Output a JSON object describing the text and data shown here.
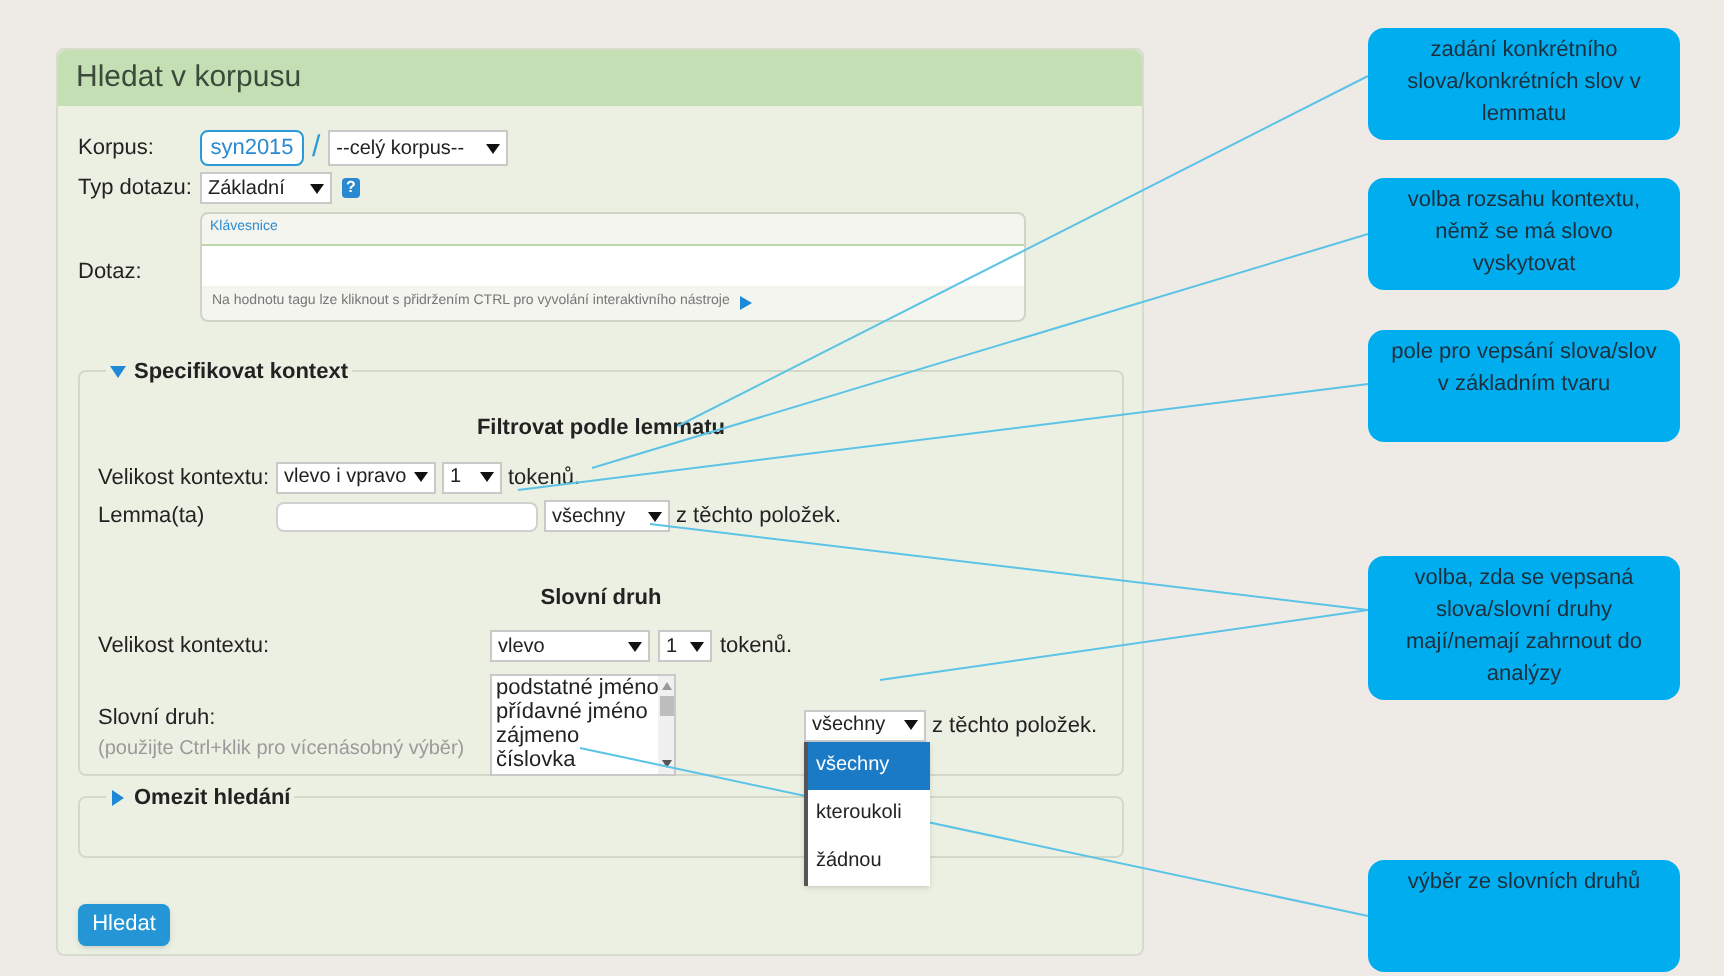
{
  "panel": {
    "title": "Hledat v korpusu"
  },
  "corpus": {
    "label": "Korpus:",
    "value": "syn2015",
    "separator": "/",
    "subcorpus": "--celý korpus--"
  },
  "query_type": {
    "label": "Typ dotazu:",
    "value": "Základní",
    "help": "?"
  },
  "query": {
    "label": "Dotaz:",
    "keyboard_tab": "Klávesnice",
    "hint": "Na hodnotu tagu lze kliknout s přidržením CTRL pro vyvolání interaktivního nástroje"
  },
  "context_section": {
    "title": "Specifikovat kontext",
    "expanded": true,
    "lemma_filter": {
      "heading": "Filtrovat podle lemmatu",
      "size_label": "Velikost kontextu:",
      "direction": "vlevo i vpravo",
      "count": "1",
      "unit": "tokenů.",
      "lemma_label": "Lemma(ta)",
      "mode": "všechny",
      "suffix": "z těchto položek."
    },
    "pos_filter": {
      "heading": "Slovní druh",
      "size_label": "Velikost kontextu:",
      "direction": "vlevo",
      "count": "1",
      "unit": "tokenů.",
      "pos_label": "Slovní druh:",
      "pos_hint": "(použijte Ctrl+klik pro vícenásobný výběr)",
      "pos_items": [
        {
          "label": "podstatné jméno",
          "selected": false
        },
        {
          "label": "přídavné jméno",
          "selected": false
        },
        {
          "label": "zájmeno",
          "selected": false
        },
        {
          "label": "číslovka",
          "selected": false
        }
      ],
      "mode": "všechny",
      "suffix": "z těchto položek.",
      "mode_expanded": true,
      "mode_options": [
        {
          "label": "všechny",
          "selected": true
        },
        {
          "label": "kteroukoli",
          "selected": false
        },
        {
          "label": "žádnou",
          "selected": false
        }
      ]
    }
  },
  "restrict_section": {
    "title": "Omezit hledání",
    "expanded": false
  },
  "search_button": "Hledat",
  "callouts": [
    {
      "text": "zadání konkrétního slova/konkrétních slov v lemmatu"
    },
    {
      "text": "volba rozsahu kontextu, němž se má slovo vyskytovat"
    },
    {
      "text": "pole pro vepsání slova/slov v základním tvaru"
    },
    {
      "text": "volba, zda se vepsaná slova/slovní druhy mají/nemají zahrnout do analýzy"
    },
    {
      "text": "výběr ze slovních druhů"
    }
  ]
}
